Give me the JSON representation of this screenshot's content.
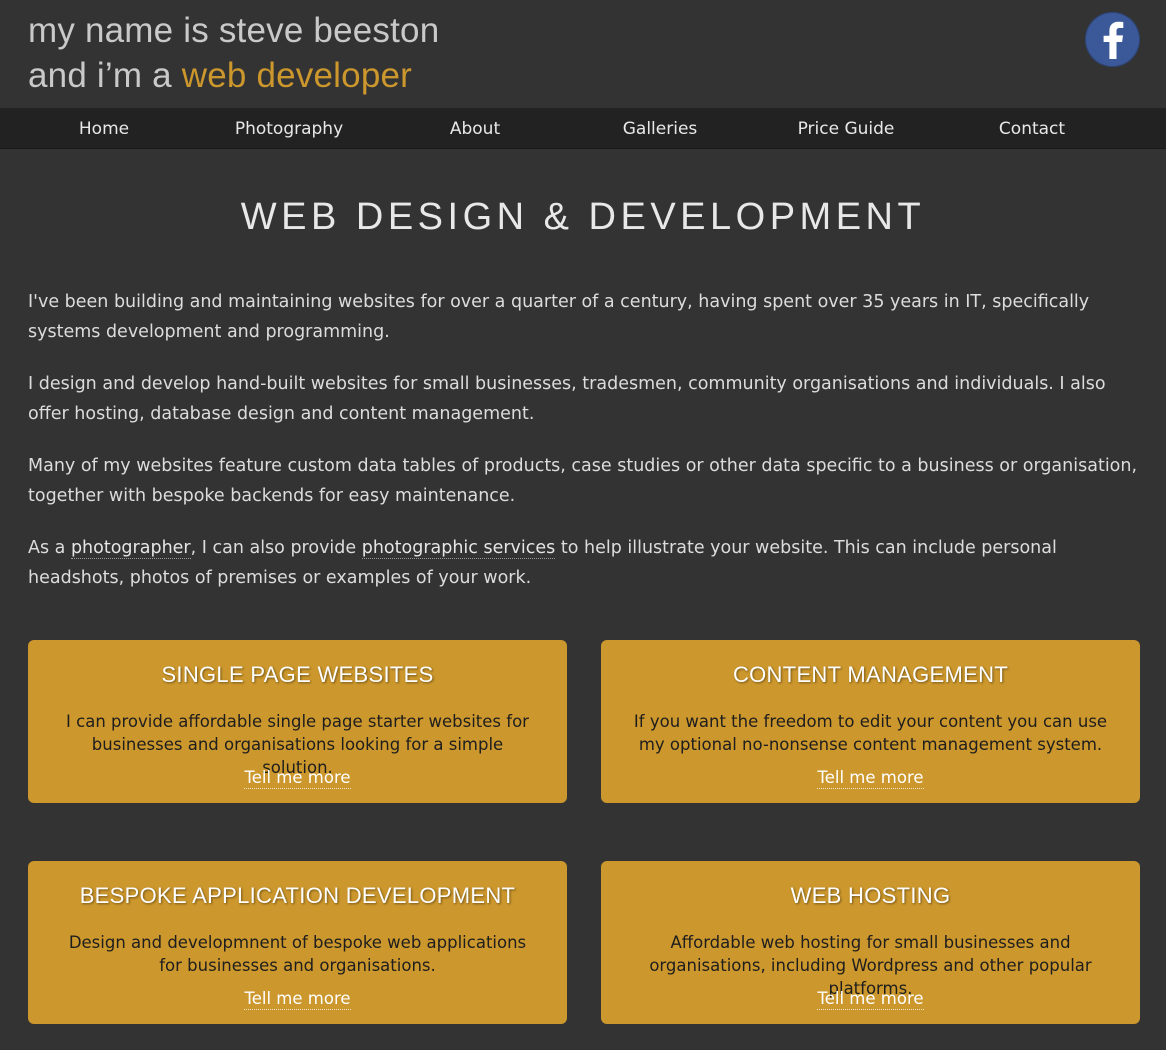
{
  "header": {
    "tagline_line1": "my name is steve beeston",
    "tagline_line2_prefix": "and i’m a ",
    "tagline_line2_accent": "web developer",
    "social_icon": "facebook-icon"
  },
  "nav": {
    "items": [
      {
        "label": "Home"
      },
      {
        "label": "Photography"
      },
      {
        "label": "About"
      },
      {
        "label": "Galleries"
      },
      {
        "label": "Price Guide"
      },
      {
        "label": "Contact"
      }
    ]
  },
  "main": {
    "title": "WEB DESIGN & DEVELOPMENT",
    "paragraphs": [
      "I've been building and maintaining websites for over a quarter of a century, having spent over 35 years in IT, specifically systems development and programming.",
      "I design and develop hand-built websites for small businesses, tradesmen, community organisations and individuals. I also offer hosting, database design and content management.",
      "Many of my websites feature custom data tables of products, case studies or other data specific to a business or organisation, together with bespoke backends for easy maintenance."
    ],
    "photo_paragraph": {
      "prefix": "As a ",
      "link1": "photographer",
      "middle": ", I can also provide ",
      "link2": "photographic services",
      "suffix": " to help illustrate your website. This can include personal headshots, photos of premises or examples of your work."
    }
  },
  "cards": [
    {
      "title": "SINGLE PAGE WEBSITES",
      "text": "I can provide affordable single page starter websites for businesses and organisations looking for a simple solution.",
      "link": "Tell me more"
    },
    {
      "title": "CONTENT MANAGEMENT",
      "text": "If you want the freedom to edit your content you can use my optional no-nonsense content management system.",
      "link": "Tell me more"
    },
    {
      "title": "BESPOKE APPLICATION DEVELOPMENT",
      "text": "Design and developmnent of bespoke web applications for businesses and organisations.",
      "link": "Tell me more"
    },
    {
      "title": "WEB HOSTING",
      "text": "Affordable web hosting for small businesses and organisations, including Wordpress and other popular platforms.",
      "link": "Tell me more"
    }
  ],
  "colors": {
    "background": "#333333",
    "nav_background": "#222222",
    "accent": "#cc972c",
    "facebook": "#3b5998"
  }
}
